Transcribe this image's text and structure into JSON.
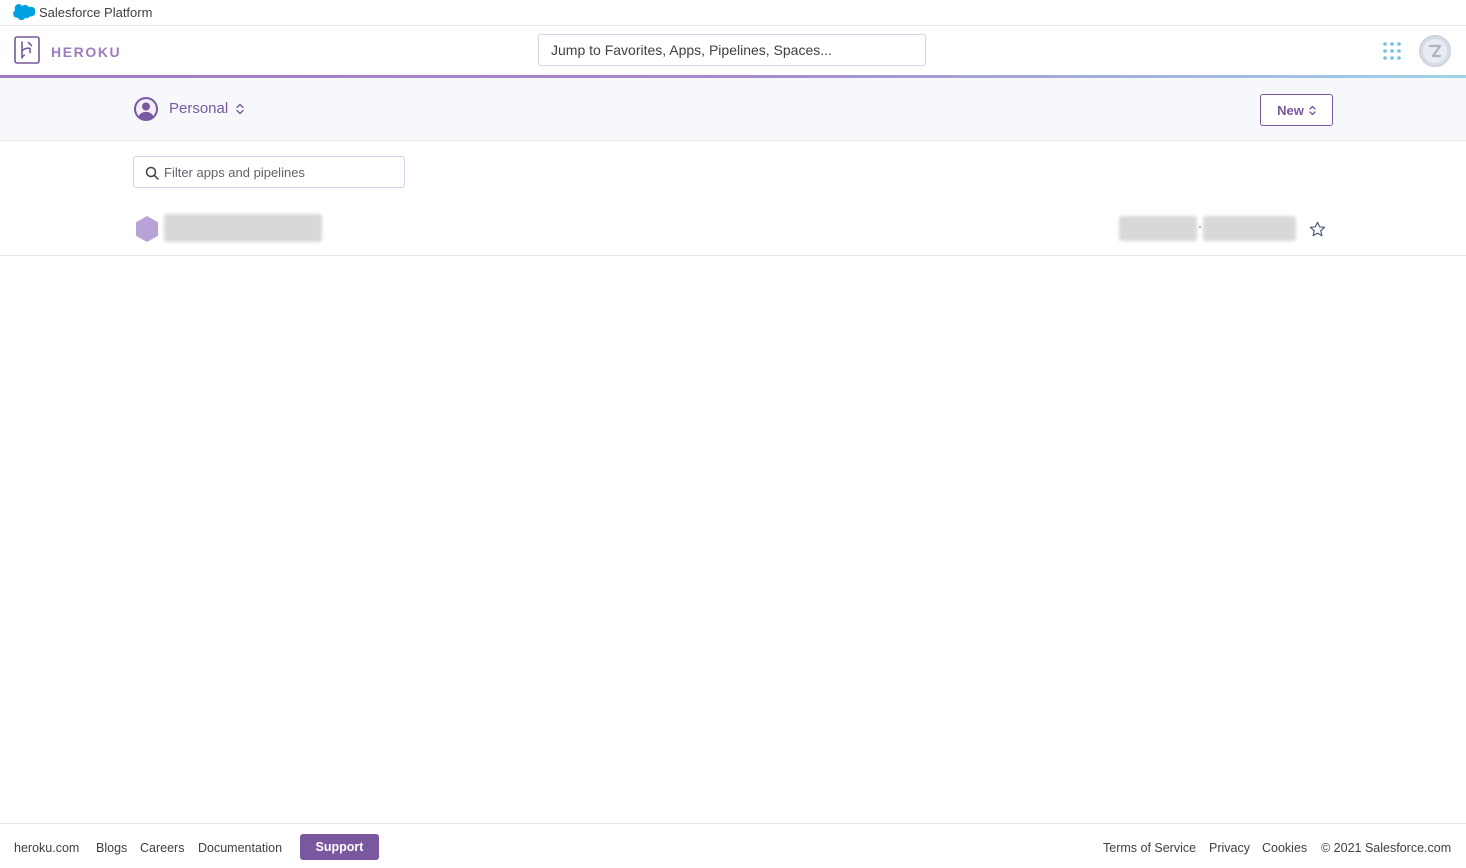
{
  "platform_bar": {
    "label": "Salesforce Platform",
    "cloud_icon": "salesforce-cloud-icon",
    "cloud_color": "#00a1e0"
  },
  "header": {
    "logo_icon": "heroku-logo-icon",
    "wordmark": "HEROKU",
    "search_placeholder": "Jump to Favorites, Apps, Pipelines, Spaces...",
    "apps_menu_icon": "apps-grid-icon",
    "avatar_icon": "user-avatar-icon",
    "brand_color": "#79589f"
  },
  "context": {
    "account_label": "Personal",
    "account_icon": "person-avatar-icon",
    "new_button_label": "New"
  },
  "filter": {
    "placeholder": "Filter apps and pipelines",
    "icon": "search-icon"
  },
  "apps": [
    {
      "name": "",
      "icon": "app-hexagon-icon",
      "name_redacted": true,
      "meta_redacted": true,
      "favorite_icon": "star-icon"
    }
  ],
  "footer": {
    "links": [
      "heroku.com",
      "Blogs",
      "Careers",
      "Documentation"
    ],
    "support_label": "Support",
    "right_links": [
      "Terms of Service",
      "Privacy",
      "Cookies"
    ],
    "copyright": "© 2021 Salesforce.com"
  }
}
